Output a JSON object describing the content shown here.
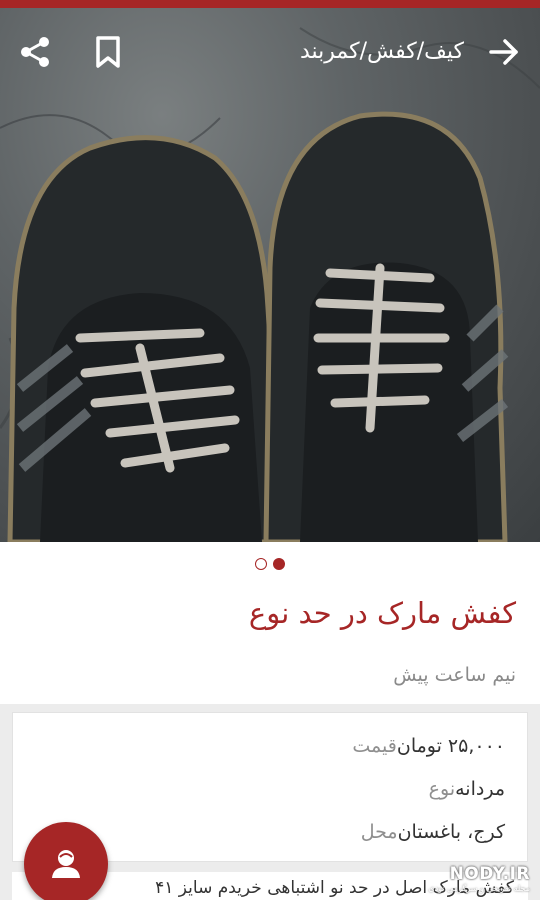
{
  "toolbar": {
    "breadcrumb": "کیف/کفش/کمربند",
    "icons": {
      "back": "arrow-forward-icon",
      "bookmark": "bookmark-icon",
      "share": "share-icon"
    }
  },
  "gallery": {
    "image": "worn-sneakers-photo",
    "image_count": 2,
    "active_index": 2
  },
  "listing": {
    "title": "کفش مارک در حد نوع",
    "time": "نیم ساعت پیش"
  },
  "details": {
    "rows": [
      {
        "label": "قیمت",
        "value": "۲۵,۰۰۰ تومان"
      },
      {
        "label": "نوع",
        "value": "مردانه"
      },
      {
        "label": "محل",
        "value": "کرج، باغستان"
      }
    ]
  },
  "description": {
    "text": "کفش مارک اصل در حد نو اشتباهی خریدم سایز ۴۱"
  },
  "watermark": {
    "main": "NODY.IR",
    "sub": "مجله تفریحی و سرگرمی نودی"
  },
  "fab": {
    "icon": "contact-icon"
  },
  "colors": {
    "accent": "#a62626",
    "muted": "#8f8f8f",
    "background": "#ececec"
  }
}
